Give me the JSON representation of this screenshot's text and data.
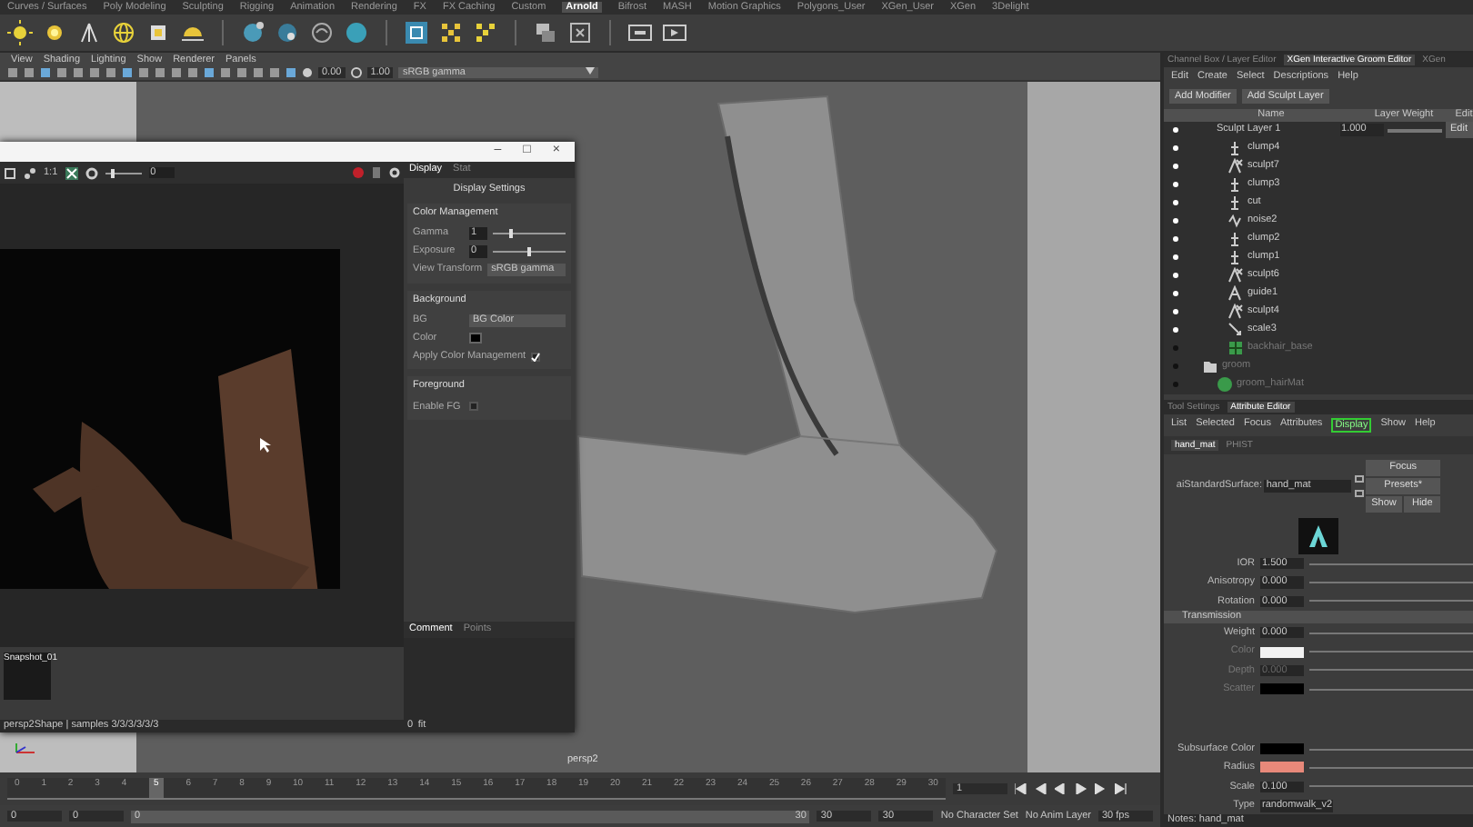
{
  "shelf_tabs": [
    {
      "label": "Curves / Surfaces",
      "selected": false
    },
    {
      "label": "Poly Modeling",
      "selected": false
    },
    {
      "label": "Sculpting",
      "selected": false
    },
    {
      "label": "Rigging",
      "selected": false
    },
    {
      "label": "Animation",
      "selected": false
    },
    {
      "label": "Rendering",
      "selected": false
    },
    {
      "label": "FX",
      "selected": false
    },
    {
      "label": "FX Caching",
      "selected": false
    },
    {
      "label": "Custom",
      "selected": false
    },
    {
      "label": "Arnold",
      "selected": true
    },
    {
      "label": "Bifrost",
      "selected": false
    },
    {
      "label": "MASH",
      "selected": false
    },
    {
      "label": "Motion Graphics",
      "selected": false
    },
    {
      "label": "Polygons_User",
      "selected": false
    },
    {
      "label": "XGen_User",
      "selected": false
    },
    {
      "label": "XGen",
      "selected": false
    },
    {
      "label": "3Delight",
      "selected": false
    }
  ],
  "viewport": {
    "menu": [
      "View",
      "Shading",
      "Lighting",
      "Show",
      "Renderer",
      "Panels"
    ],
    "exposure": "0.00",
    "gamma": "1.00",
    "color_space": "sRGB gamma",
    "camera_label": "persp2"
  },
  "render_view": {
    "window_buttons": [
      "–",
      "□",
      "×"
    ],
    "zoom_label": "1:1",
    "toolbar_slider": {
      "value": "0",
      "level": 0.2
    },
    "tabs": [
      {
        "label": "Display",
        "selected": true
      },
      {
        "label": "Stat",
        "selected": false
      }
    ],
    "heading": "Display Settings",
    "sections": [
      {
        "title": "Color Management",
        "rows": [
          {
            "kind": "slider",
            "label": "Gamma",
            "value": "1",
            "level": 0.25
          },
          {
            "kind": "slider",
            "label": "Exposure",
            "value": "0",
            "level": 0.5
          },
          {
            "kind": "select",
            "label": "View Transform",
            "value": "sRGB gamma"
          }
        ]
      },
      {
        "title": "Background",
        "rows": [
          {
            "kind": "select",
            "label": "BG",
            "value": "BG Color"
          },
          {
            "kind": "swatch",
            "label": "Color",
            "color": "#000000"
          },
          {
            "kind": "checkbox",
            "label": "Apply Color Management",
            "checked": true
          }
        ]
      },
      {
        "title": "Foreground",
        "rows": [
          {
            "kind": "checkbox",
            "label": "Enable FG",
            "checked": false
          }
        ]
      }
    ],
    "snapshots": [
      "Snapshot_01"
    ],
    "bottom_tabs": [
      {
        "label": "Comment",
        "selected": true
      },
      {
        "label": "Points",
        "selected": false
      }
    ],
    "status": "persp2Shape | samples 3/3/3/3/3/3",
    "zoom_value": "0",
    "fit_label": "fit"
  },
  "groom_editor": {
    "tabs": [
      {
        "label": "Channel Box / Layer Editor",
        "selected": false
      },
      {
        "label": "XGen Interactive Groom Editor",
        "selected": true
      },
      {
        "label": "XGen",
        "selected": false
      }
    ],
    "menu": [
      "Edit",
      "Create",
      "Select",
      "Descriptions",
      "Help"
    ],
    "buttons": [
      "Add Modifier",
      "Add Sculpt Layer"
    ],
    "columns": [
      "Name",
      "Layer Weight",
      "Edit"
    ],
    "sculpt_layer": {
      "name": "Sculpt Layer 1",
      "weight": "1.000",
      "level": 1,
      "edit": "Edit"
    },
    "modifiers": [
      {
        "name": "clump4",
        "kind": "clump",
        "active": true
      },
      {
        "name": "sculpt7",
        "kind": "sculpt",
        "active": true
      },
      {
        "name": "clump3",
        "kind": "clump",
        "active": true
      },
      {
        "name": "cut",
        "kind": "clump",
        "active": true
      },
      {
        "name": "noise2",
        "kind": "noise",
        "active": true
      },
      {
        "name": "clump2",
        "kind": "clump",
        "active": true
      },
      {
        "name": "clump1",
        "kind": "clump",
        "active": true
      },
      {
        "name": "sculpt6",
        "kind": "sculpt",
        "active": true
      },
      {
        "name": "guide1",
        "kind": "guide",
        "active": true
      },
      {
        "name": "sculpt4",
        "kind": "sculpt",
        "active": true
      },
      {
        "name": "scale3",
        "kind": "scale",
        "active": true
      },
      {
        "name": "backhair_base",
        "kind": "base",
        "active": false
      }
    ],
    "descriptions": [
      {
        "name": "groom",
        "active": false,
        "children": [
          {
            "name": "groom_hairMat",
            "active": false
          }
        ]
      }
    ]
  },
  "attribute_editor": {
    "tabs": [
      {
        "label": "Tool Settings",
        "selected": false
      },
      {
        "label": "Attribute Editor",
        "selected": true
      }
    ],
    "menu": [
      {
        "label": "List",
        "highlighted": false
      },
      {
        "label": "Selected",
        "highlighted": false
      },
      {
        "label": "Focus",
        "highlighted": false
      },
      {
        "label": "Attributes",
        "highlighted": false
      },
      {
        "label": "Display",
        "highlighted": true
      },
      {
        "label": "Show",
        "highlighted": false
      },
      {
        "label": "Help",
        "highlighted": false
      }
    ],
    "node_tabs": [
      {
        "label": "hand_mat",
        "selected": true
      },
      {
        "label": "PHIST",
        "selected": false
      }
    ],
    "node_type": "aiStandardSurface:",
    "node_name": "hand_mat",
    "buttons": [
      "Focus",
      "Presets*",
      "Show",
      "Hide"
    ],
    "attributes": [
      {
        "kind": "number",
        "label": "IOR",
        "value": "1.500",
        "disabled": false
      },
      {
        "kind": "number",
        "label": "Anisotropy",
        "value": "0.000",
        "disabled": false
      },
      {
        "kind": "number",
        "label": "Rotation",
        "value": "0.000",
        "disabled": false
      },
      {
        "kind": "section",
        "label": "Transmission"
      },
      {
        "kind": "number",
        "label": "Weight",
        "value": "0.000",
        "disabled": false
      },
      {
        "kind": "swatch",
        "label": "Color",
        "color": "#f2f2f2",
        "disabled": true
      },
      {
        "kind": "number",
        "label": "Depth",
        "value": "0.000",
        "disabled": true
      },
      {
        "kind": "swatch",
        "label": "Scatter",
        "color": "#000000",
        "disabled": true
      },
      {
        "kind": "gap"
      },
      {
        "kind": "swatch",
        "label": "Subsurface Color",
        "color": "#000000",
        "disabled": false
      },
      {
        "kind": "swatch",
        "label": "Radius",
        "color": "#e8897a",
        "disabled": false
      },
      {
        "kind": "number",
        "label": "Scale",
        "value": "0.100",
        "disabled": false
      },
      {
        "kind": "select",
        "label": "Type",
        "value": "randomwalk_v2",
        "disabled": false
      }
    ],
    "notes": "Notes: hand_mat"
  },
  "timeline": {
    "ticks": [
      {
        "label": "0",
        "selected": false
      },
      {
        "label": "1",
        "selected": false
      },
      {
        "label": "2",
        "selected": false
      },
      {
        "label": "3",
        "selected": false
      },
      {
        "label": "4",
        "selected": false
      },
      {
        "label": "5",
        "selected": true
      },
      {
        "label": "6",
        "selected": false
      },
      {
        "label": "7",
        "selected": false
      },
      {
        "label": "8",
        "selected": false
      },
      {
        "label": "9",
        "selected": false
      },
      {
        "label": "10",
        "selected": false
      },
      {
        "label": "11",
        "selected": false
      },
      {
        "label": "12",
        "selected": false
      },
      {
        "label": "13",
        "selected": false
      },
      {
        "label": "14",
        "selected": false
      },
      {
        "label": "15",
        "selected": false
      },
      {
        "label": "16",
        "selected": false
      },
      {
        "label": "17",
        "selected": false
      },
      {
        "label": "18",
        "selected": false
      },
      {
        "label": "19",
        "selected": false
      },
      {
        "label": "20",
        "selected": false
      },
      {
        "label": "21",
        "selected": false
      },
      {
        "label": "22",
        "selected": false
      },
      {
        "label": "23",
        "selected": false
      },
      {
        "label": "24",
        "selected": false
      },
      {
        "label": "25",
        "selected": false
      },
      {
        "label": "26",
        "selected": false
      },
      {
        "label": "27",
        "selected": false
      },
      {
        "label": "28",
        "selected": false
      },
      {
        "label": "29",
        "selected": false
      },
      {
        "label": "30",
        "selected": false
      }
    ],
    "current_frame": "1"
  },
  "range_bar": {
    "level": 1,
    "start": "0",
    "playback_start": "0",
    "range_start": "0",
    "range_end": "30",
    "playback_end": "30",
    "end": "30",
    "character_set": "No Character Set",
    "anim_layer": "No Anim Layer",
    "fps": "30 fps"
  }
}
